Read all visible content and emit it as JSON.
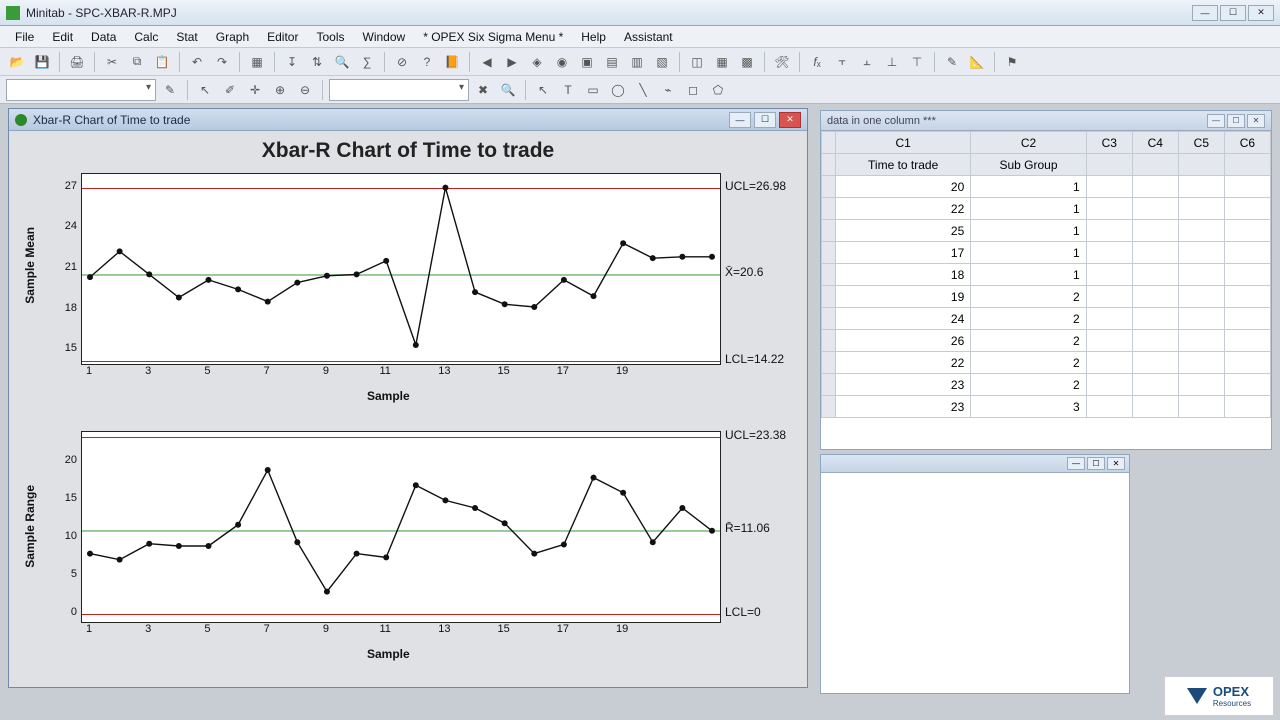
{
  "app": {
    "title": "Minitab - SPC-XBAR-R.MPJ"
  },
  "menu": [
    "File",
    "Edit",
    "Data",
    "Calc",
    "Stat",
    "Graph",
    "Editor",
    "Tools",
    "Window",
    "* OPEX Six Sigma Menu *",
    "Help",
    "Assistant"
  ],
  "chart_window": {
    "title": "Xbar-R Chart of Time to trade"
  },
  "sheet_window": {
    "title": "data in one column ***"
  },
  "sheet": {
    "columns": [
      "C1",
      "C2",
      "C3",
      "C4",
      "C5",
      "C6"
    ],
    "col_names": [
      "Time to trade",
      "Sub Group",
      "",
      "",
      "",
      ""
    ],
    "rows": [
      [
        20,
        1
      ],
      [
        22,
        1
      ],
      [
        25,
        1
      ],
      [
        17,
        1
      ],
      [
        18,
        1
      ],
      [
        19,
        2
      ],
      [
        24,
        2
      ],
      [
        26,
        2
      ],
      [
        22,
        2
      ],
      [
        23,
        2
      ],
      [
        23,
        3
      ]
    ]
  },
  "opex": {
    "label": "OPEX",
    "sub": "Resources"
  },
  "chart_data": [
    {
      "type": "line",
      "name": "Xbar",
      "title": "Xbar-R Chart of Time to trade",
      "xlabel": "Sample",
      "ylabel": "Sample Mean",
      "x": [
        1,
        2,
        3,
        4,
        5,
        6,
        7,
        8,
        9,
        10,
        11,
        12,
        13,
        14,
        15,
        16,
        17,
        18,
        19,
        20
      ],
      "values": [
        20.4,
        22.3,
        20.6,
        18.9,
        20.2,
        19.5,
        18.6,
        20.0,
        20.5,
        20.6,
        21.6,
        15.4,
        27.0,
        19.3,
        18.4,
        18.2,
        20.2,
        19.0,
        22.9,
        21.8
      ],
      "extra_x": [
        21,
        22
      ],
      "extra_values": [
        21.9,
        21.9
      ],
      "yticks": [
        15,
        18,
        21,
        24,
        27
      ],
      "xticks": [
        1,
        3,
        5,
        7,
        9,
        11,
        13,
        15,
        17,
        19
      ],
      "limits": {
        "UCL": 26.98,
        "Center": 20.6,
        "CenterLabel": "X̄=20.6",
        "LCL": 14.22
      },
      "ylim": [
        14,
        28
      ]
    },
    {
      "type": "line",
      "name": "R",
      "xlabel": "Sample",
      "ylabel": "Sample Range",
      "x": [
        1,
        2,
        3,
        4,
        5,
        6,
        7,
        8,
        9,
        10,
        11,
        12,
        13,
        14,
        15,
        16,
        17,
        18,
        19,
        20
      ],
      "values": [
        8.0,
        7.2,
        9.3,
        9.0,
        9.0,
        11.8,
        19.0,
        9.5,
        3.0,
        8.0,
        7.5,
        17.0,
        15.0,
        14.0,
        12.0,
        8.0,
        9.2,
        18.0,
        16.0,
        9.5
      ],
      "extra_x": [
        21,
        22
      ],
      "extra_values": [
        14.0,
        11.0
      ],
      "yticks": [
        0,
        5,
        10,
        15,
        20
      ],
      "xticks": [
        1,
        3,
        5,
        7,
        9,
        11,
        13,
        15,
        17,
        19
      ],
      "limits": {
        "UCL": 23.38,
        "Center": 11.06,
        "CenterLabel": "R̄=11.06",
        "LCL": 0
      },
      "ylim": [
        -1,
        24
      ]
    }
  ]
}
